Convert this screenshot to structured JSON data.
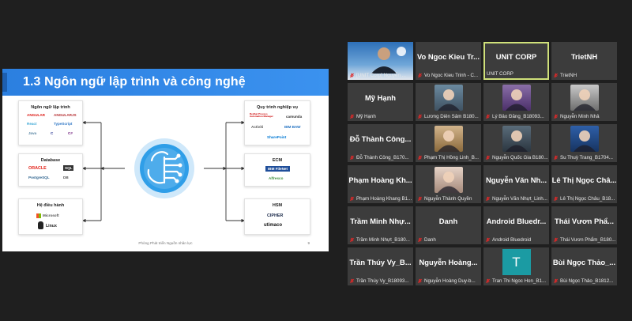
{
  "slide": {
    "title": "1.3 Ngôn ngữ lập trình và công nghệ",
    "footer": "Phòng Phát triển Nguồn nhân lực",
    "page_number": "9",
    "boxes": {
      "languages": {
        "title": "Ngôn ngữ lập trình",
        "logos": [
          "ANGULAR",
          "ANGULARJS",
          "React",
          "TypeScript",
          "Java",
          "C",
          "C#"
        ]
      },
      "database": {
        "title": "Database",
        "logos": [
          "ORACLE",
          "SQL",
          "PostgreSQL",
          "DB"
        ]
      },
      "os": {
        "title": "Hệ điều hành",
        "logos": [
          "Microsoft",
          "Linux"
        ]
      },
      "process": {
        "title": "Quy trình nghiệp vụ",
        "logos": [
          "Redhat Process Automation Manager",
          "camunda",
          "Activiti",
          "IBM BAW",
          "SharePoint"
        ]
      },
      "ecm": {
        "title": "ECM",
        "logos": [
          "IBM FileNet",
          "Alfresco"
        ]
      },
      "hsm": {
        "title": "HSM",
        "logos": [
          "CIPHER",
          "utimaco"
        ]
      }
    }
  },
  "participants": [
    {
      "name": "[UNIT Corp] Nguyễn ...",
      "tile_label": "",
      "type": "video",
      "muted": true
    },
    {
      "name": "Vo Ngoc Kieu Trinh - C...",
      "tile_label": "Vo Ngoc Kieu Tr...",
      "type": "label",
      "muted": true
    },
    {
      "name": "UNIT CORP",
      "tile_label": "UNIT CORP",
      "type": "label",
      "muted": false,
      "highlight": true
    },
    {
      "name": "TrietNH",
      "tile_label": "TrietNH",
      "type": "label",
      "muted": true
    },
    {
      "name": "Mỹ Hạnh",
      "tile_label": "Mỹ Hạnh",
      "type": "label",
      "muted": true
    },
    {
      "name": "Lương Diên Sâm B180...",
      "tile_label": "",
      "type": "photo",
      "muted": true
    },
    {
      "name": "Lý Bảo Đăng_B18093...",
      "tile_label": "",
      "type": "photo",
      "muted": true
    },
    {
      "name": "Nguyễn Minh Nhả",
      "tile_label": "",
      "type": "photo",
      "muted": true
    },
    {
      "name": "Đỗ Thành Công_B170...",
      "tile_label": "Đỗ Thành Công...",
      "type": "label",
      "muted": true
    },
    {
      "name": "Phạm Thị Hồng Linh_B...",
      "tile_label": "",
      "type": "photo",
      "muted": true
    },
    {
      "name": "Nguyễn Quốc Gia B180...",
      "tile_label": "",
      "type": "photo",
      "muted": true
    },
    {
      "name": "Su Thuỳ Trang_B1704...",
      "tile_label": "",
      "type": "photo",
      "muted": true
    },
    {
      "name": "Phạm Hoàng Khang B1...",
      "tile_label": "Phạm Hoàng Kh...",
      "type": "label",
      "muted": true
    },
    {
      "name": "Nguyễn Thành Quyền",
      "tile_label": "",
      "type": "photo",
      "muted": true
    },
    {
      "name": "Nguyễn Văn Nhựt_Linh...",
      "tile_label": "Nguyễn Văn Nh...",
      "type": "label",
      "muted": true
    },
    {
      "name": "Lê Thị Ngọc Châu_B18...",
      "tile_label": "Lê Thị Ngọc Châ...",
      "type": "label",
      "muted": true
    },
    {
      "name": "Trầm Minh Nhựt_B180...",
      "tile_label": "Trầm Minh Nhự...",
      "type": "label",
      "muted": true
    },
    {
      "name": "Danh",
      "tile_label": "Danh",
      "type": "label",
      "muted": true
    },
    {
      "name": "Android Bluedroid",
      "tile_label": "Android Bluedr...",
      "type": "label",
      "muted": true
    },
    {
      "name": "Thái Vươn Phẩm_B180...",
      "tile_label": "Thái Vươn Phẩ...",
      "type": "label",
      "muted": true
    },
    {
      "name": "Trần Thúy Vy_B18093...",
      "tile_label": "Trần Thúy Vy_B...",
      "type": "label",
      "muted": true
    },
    {
      "name": "Nguyễn Hoàng Duy-b...",
      "tile_label": "Nguyễn Hoàng...",
      "type": "label",
      "muted": true
    },
    {
      "name": "Tran Thi Ngoc Hon_B1...",
      "tile_label": "T",
      "type": "letter",
      "muted": true
    },
    {
      "name": "Bùi Ngọc Thảo_B1812...",
      "tile_label": "Bùi Ngọc Thảo_...",
      "type": "label",
      "muted": true
    }
  ],
  "colors": {
    "slide_header": "#2b7fe0",
    "tile_bg": "#3c3c3c",
    "highlight": "#cfe07a",
    "muted_icon": "#e02828"
  }
}
